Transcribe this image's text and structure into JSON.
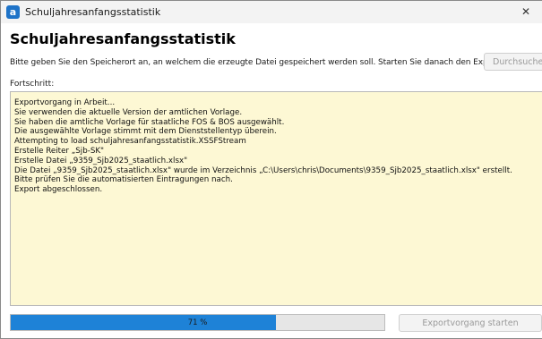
{
  "window": {
    "app_icon_letter": "a",
    "title": "Schuljahresanfangsstatistik",
    "close_glyph": "✕"
  },
  "header": {
    "heading": "Schuljahresanfangsstatistik"
  },
  "save_location": {
    "instruction": "Bitte geben Sie den Speicherort an, an welchem die erzeugte Datei gespeichert werden soll. Starten Sie danach den Exportvorgang.",
    "browse_label": "Durchsuchen..."
  },
  "progress": {
    "label": "Fortschritt:",
    "percent": 71,
    "percent_text": "71 %",
    "fill_color": "#1e82d7"
  },
  "log": {
    "lines": [
      "Exportvorgang in Arbeit...",
      "Sie verwenden die aktuelle Version der amtlichen Vorlage.",
      "Sie haben die amtliche Vorlage für staatliche FOS & BOS ausgewählt.",
      "Die ausgewählte Vorlage stimmt mit dem Dienststellentyp überein.",
      "Attempting to load schuljahresanfangsstatistik.XSSFStream",
      "Erstelle Reiter „Sjb-SK\"",
      "Erstelle Datei „9359_Sjb2025_staatlich.xlsx\"",
      "Die Datei „9359_Sjb2025_staatlich.xlsx\" wurde im Verzeichnis „C:\\Users\\chris\\Documents\\9359_Sjb2025_staatlich.xlsx\" erstellt.",
      "Bitte prüfen Sie die automatisierten Eintragungen nach.",
      "Export abgeschlossen."
    ],
    "background": "#fdf8d4"
  },
  "actions": {
    "export_label": "Exportvorgang starten"
  }
}
